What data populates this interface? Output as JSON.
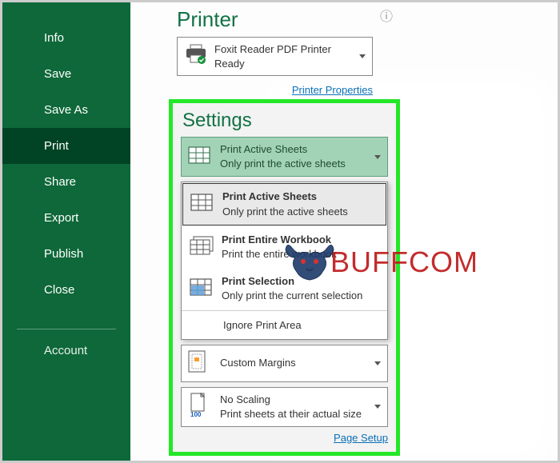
{
  "sidebar": {
    "items": [
      {
        "label": "Info"
      },
      {
        "label": "Save"
      },
      {
        "label": "Save As"
      },
      {
        "label": "Print"
      },
      {
        "label": "Share"
      },
      {
        "label": "Export"
      },
      {
        "label": "Publish"
      },
      {
        "label": "Close"
      }
    ],
    "account_label": "Account"
  },
  "printer": {
    "heading": "Printer",
    "name": "Foxit Reader PDF Printer",
    "status": "Ready",
    "properties_link": "Printer Properties"
  },
  "settings": {
    "heading": "Settings",
    "active": {
      "title": "Print Active Sheets",
      "desc": "Only print the active sheets"
    },
    "dropdown": {
      "opt1": {
        "title": "Print Active Sheets",
        "desc": "Only print the active sheets"
      },
      "opt2": {
        "title": "Print Entire Workbook",
        "desc": "Print the entire workbook"
      },
      "opt3": {
        "title": "Print Selection",
        "desc": "Only print the current selection"
      },
      "ignore": "Ignore Print Area"
    },
    "margins": "Custom Margins",
    "scaling": {
      "title": "No Scaling",
      "desc": "Print sheets at their actual size",
      "hundred": "100"
    },
    "page_setup_link": "Page Setup"
  },
  "watermark": "BUFFCOM"
}
